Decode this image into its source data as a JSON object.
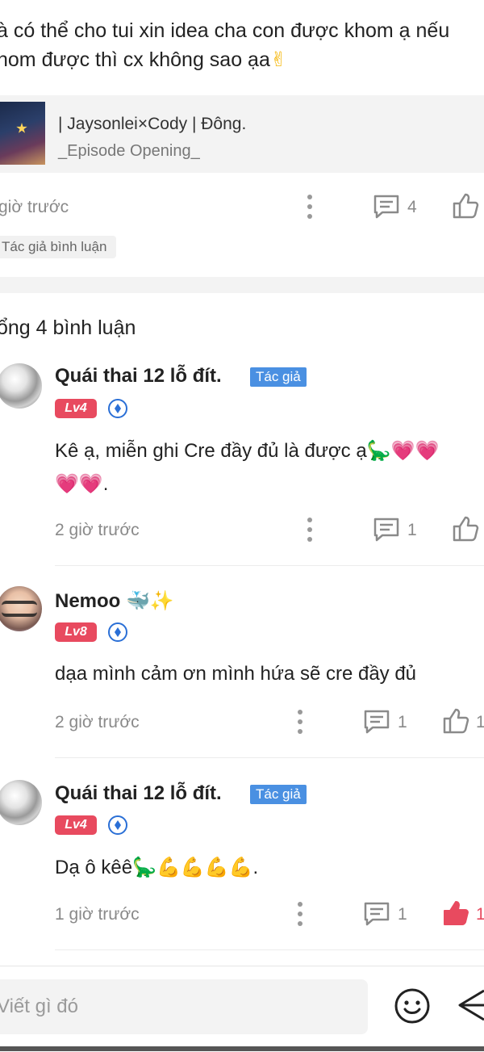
{
  "post": {
    "text_line1": "à có thể cho tui xin idea cha con được khom ạ nếu",
    "text_line2": "hom được thì cx không sao ạa",
    "emoji_peace": "✌",
    "book": {
      "title": "| Jaysonlei×Cody | Đông.",
      "subtitle": "_Episode Opening_"
    },
    "time": "giờ trước",
    "reply_count": "4",
    "author_comment_tag": "Tác giả bình luận"
  },
  "comments_header": {
    "total": "ổng 4 bình luận"
  },
  "comments": [
    {
      "username": "Quái thai 12 lỗ đít.",
      "author_tag": "Tác giả",
      "level": "Lv4",
      "text_line1": "Kê ạ, miễn ghi Cre đầy đủ là được ạ",
      "text_line2": ".",
      "time": "2 giờ trước",
      "reply_count": "1"
    },
    {
      "username": "Nemoo",
      "level": "Lv8",
      "text": "dạa mình cảm ơn mình hứa sẽ cre đầy đủ",
      "time": "2 giờ trước",
      "reply_count": "1",
      "like_count": "1"
    },
    {
      "username": "Quái thai 12 lỗ đít.",
      "author_tag": "Tác giả",
      "level": "Lv4",
      "text": "Dạ ô kêê",
      "text_suffix": ".",
      "time": "1 giờ trước",
      "reply_count": "1",
      "like_count": "1",
      "liked": true
    }
  ],
  "composer": {
    "placeholder": "Viết gì đó"
  },
  "colors": {
    "accent_blue": "#4a90e2",
    "level_red": "#e84a5f",
    "liked_red": "#e84a5f",
    "muted": "#8a8a8a"
  },
  "icons": [
    "kebab-icon",
    "reply-icon",
    "thumbs-up-icon",
    "emoji-icon",
    "send-icon"
  ]
}
